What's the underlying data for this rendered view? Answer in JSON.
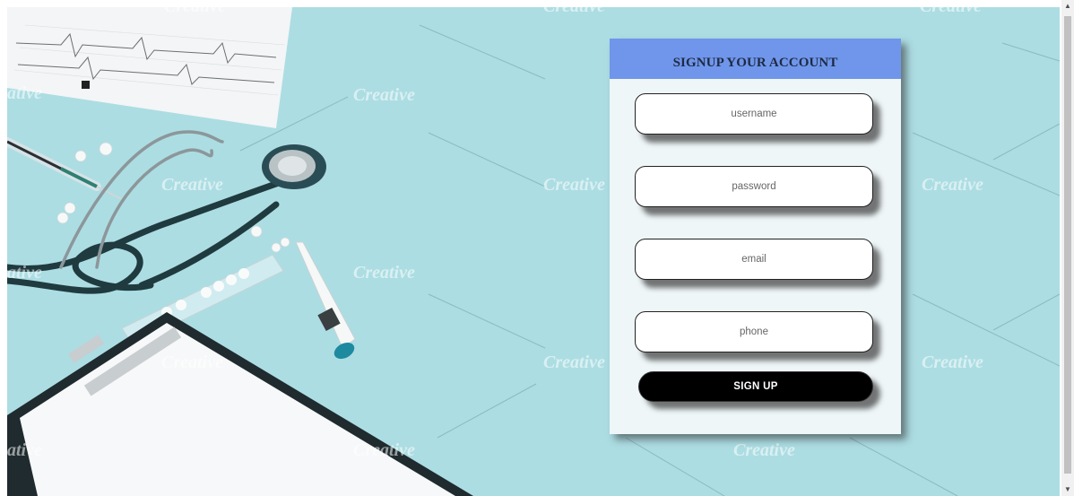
{
  "form": {
    "title": "SIGNUP YOUR ACCOUNT",
    "fields": [
      {
        "placeholder": "username",
        "value": ""
      },
      {
        "placeholder": "password",
        "value": ""
      },
      {
        "placeholder": "email",
        "value": ""
      },
      {
        "placeholder": "phone",
        "value": ""
      }
    ],
    "submit_label": "SIGN UP"
  },
  "background": {
    "watermark": "Creative"
  },
  "colors": {
    "background_teal": "#acdde3",
    "header_blue": "#6f96ea",
    "card_bg": "#eef6f8",
    "button_bg": "#000000"
  }
}
